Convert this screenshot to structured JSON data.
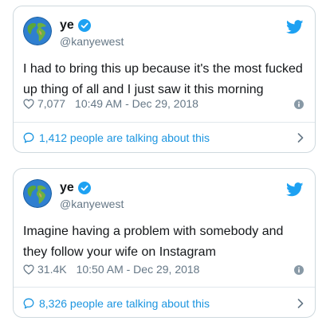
{
  "colors": {
    "accent": "#1da1f2",
    "link": "#1b95e0",
    "text": "#14171a",
    "muted": "#657786",
    "border": "#cfd9de"
  },
  "icons": [
    "globe-avatar-icon",
    "verified-badge-icon",
    "twitter-bird-icon",
    "heart-icon",
    "info-icon",
    "chat-bubble-icon",
    "chevron-right-icon"
  ],
  "tweets": [
    {
      "name": "ye",
      "handle": "@kanyewest",
      "line1": "I had to bring this up because it's the most fucked",
      "line2": "up thing of all and I just saw it this morning",
      "likes": "7,077",
      "timestamp": "10:49 AM - Dec 29, 2018",
      "talking": "1,412 people are talking about this"
    },
    {
      "name": "ye",
      "handle": "@kanyewest",
      "line1": "Imagine having a problem with somebody and",
      "line2": "they follow your wife on Instagram",
      "likes": "31.4K",
      "timestamp": "10:50 AM - Dec 29, 2018",
      "talking": "8,326 people are talking about this"
    }
  ]
}
